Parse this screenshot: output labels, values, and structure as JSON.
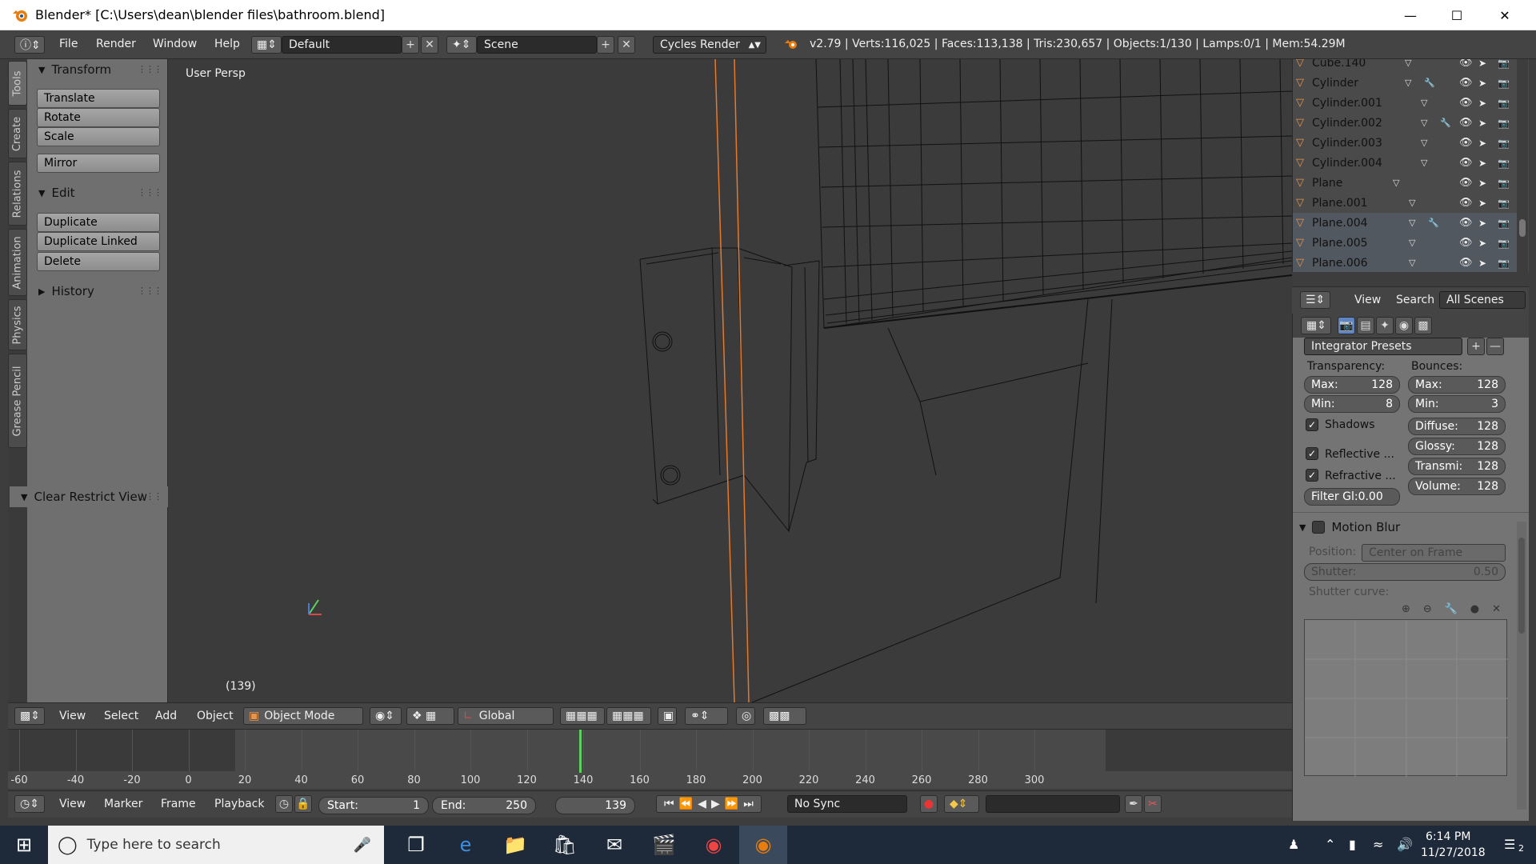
{
  "window": {
    "title": "Blender* [C:\\Users\\dean\\blender files\\bathroom.blend]"
  },
  "menubar": {
    "items": [
      "File",
      "Render",
      "Window",
      "Help"
    ],
    "screen_layout": "Default",
    "scene": "Scene",
    "render_engine": "Cycles Render",
    "stats": "v2.79 | Verts:116,025 | Faces:113,138 | Tris:230,657 | Objects:1/130 | Lamps:0/1 | Mem:54.29M"
  },
  "tool_tabs": [
    "Tools",
    "Create",
    "Relations",
    "Animation",
    "Physics",
    "Grease Pencil"
  ],
  "toolshelf": {
    "transform": {
      "title": "Transform",
      "buttons": [
        "Translate",
        "Rotate",
        "Scale",
        "Mirror"
      ]
    },
    "edit": {
      "title": "Edit",
      "buttons": [
        "Duplicate",
        "Duplicate Linked",
        "Delete"
      ]
    },
    "history": {
      "title": "History"
    },
    "clear_restrict": {
      "title": "Clear Restrict View"
    }
  },
  "viewport": {
    "view_name": "User Persp",
    "frame_display": "(139)"
  },
  "viewport_header": {
    "menus": [
      "View",
      "Select",
      "Add",
      "Object"
    ],
    "mode": "Object Mode",
    "orientation": "Global"
  },
  "timeline": {
    "ticks": [
      "-60",
      "-40",
      "-20",
      "0",
      "20",
      "40",
      "60",
      "80",
      "100",
      "120",
      "140",
      "160",
      "180",
      "200",
      "220",
      "240",
      "260",
      "280",
      "300"
    ],
    "current_frame": 139
  },
  "timeline_header": {
    "menus": [
      "View",
      "Marker",
      "Frame",
      "Playback"
    ],
    "start_label": "Start:",
    "start_value": "1",
    "end_label": "End:",
    "end_value": "250",
    "current_value": "139",
    "sync": "No Sync"
  },
  "outliner": {
    "items": [
      "Cube.140",
      "Cylinder",
      "Cylinder.001",
      "Cylinder.002",
      "Cylinder.003",
      "Cylinder.004",
      "Plane",
      "Plane.001",
      "Plane.004",
      "Plane.005",
      "Plane.006"
    ],
    "header": {
      "view": "View",
      "search": "Search",
      "filter": "All Scenes"
    }
  },
  "properties": {
    "presets": "Integrator Presets",
    "transparency": {
      "label": "Transparency:",
      "max_label": "Max:",
      "max": "128",
      "min_label": "Min:",
      "min": "8"
    },
    "bounces": {
      "label": "Bounces:",
      "max_label": "Max:",
      "max": "128",
      "min_label": "Min:",
      "min": "3"
    },
    "shadows": "Shadows",
    "reflective": "Reflective ...",
    "refractive": "Refractive ...",
    "filter_gi": "Filter Gl:0.00",
    "diffuse": {
      "label": "Diffuse:",
      "value": "128"
    },
    "glossy": {
      "label": "Glossy:",
      "value": "128"
    },
    "transmission": {
      "label": "Transmi:",
      "value": "128"
    },
    "volume": {
      "label": "Volume:",
      "value": "128"
    },
    "motion_blur": {
      "title": "Motion Blur",
      "position_label": "Position:",
      "position": "Center on Frame",
      "shutter_label": "Shutter:",
      "shutter": "0.50",
      "curve_label": "Shutter curve:"
    }
  },
  "taskbar": {
    "search_placeholder": "Type here to search",
    "time": "6:14 PM",
    "date": "11/27/2018",
    "notifications": "2"
  }
}
